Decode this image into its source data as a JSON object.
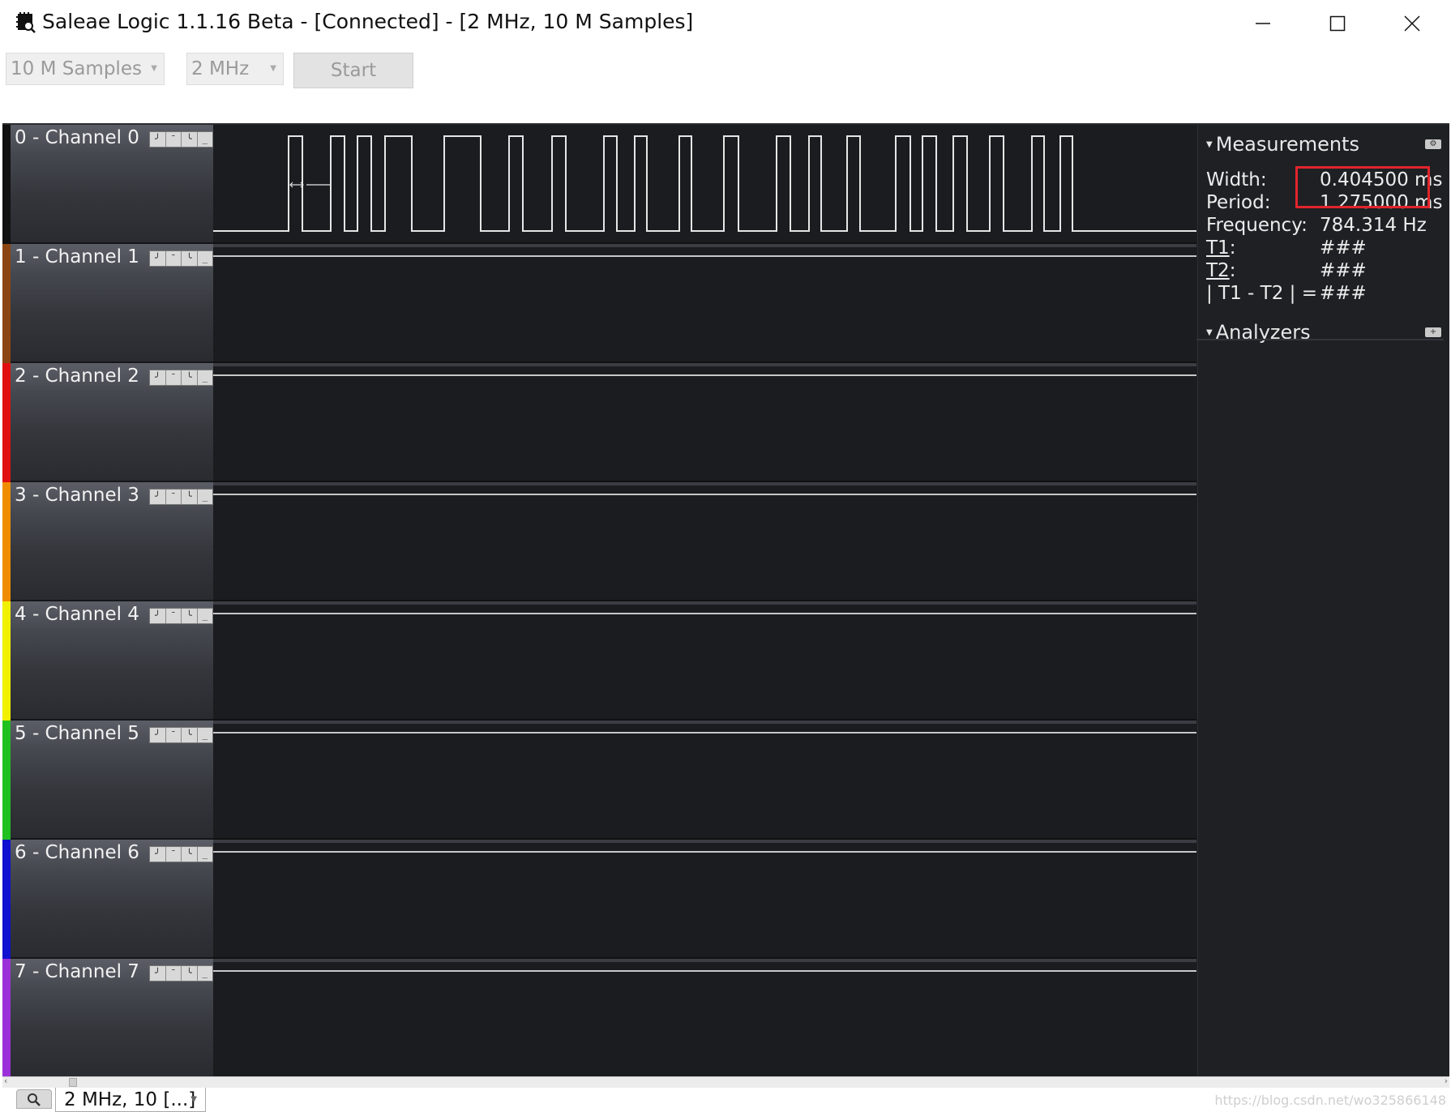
{
  "window": {
    "title": "Saleae Logic 1.1.16 Beta - [Connected] - [2 MHz, 10 M Samples]",
    "app_icon": "saleae-logo-icon",
    "controls": [
      "minimize-icon",
      "maximize-icon",
      "close-icon"
    ]
  },
  "toolbar": {
    "samples_value": "10 M Samples",
    "rate_value": "2 MHz",
    "start_label": "Start"
  },
  "channels": [
    {
      "label": "0 - Channel 0",
      "color": "#111111",
      "has_signal": true
    },
    {
      "label": "1 - Channel 1",
      "color": "#8b4513",
      "has_signal": false
    },
    {
      "label": "2 - Channel 2",
      "color": "#e01010",
      "has_signal": false
    },
    {
      "label": "3 - Channel 3",
      "color": "#f08c00",
      "has_signal": false
    },
    {
      "label": "4 - Channel 4",
      "color": "#f0f000",
      "has_signal": false
    },
    {
      "label": "5 - Channel 5",
      "color": "#20c020",
      "has_signal": false
    },
    {
      "label": "6 - Channel 6",
      "color": "#1010d0",
      "has_signal": false
    },
    {
      "label": "7 - Channel 7",
      "color": "#9b30d9",
      "has_signal": false
    }
  ],
  "trigger_buttons": [
    "rising-edge-icon",
    "high-level-icon",
    "falling-edge-icon",
    "low-level-icon"
  ],
  "measurements": {
    "title": "Measurements",
    "rows": [
      {
        "key": "Width:",
        "value": "0.404500 ms"
      },
      {
        "key": "Period:",
        "value": "1.275000 ms"
      },
      {
        "key": "Frequency:",
        "value": "784.314 Hz"
      },
      {
        "key": "T1",
        "suffix": ":",
        "value": "###"
      },
      {
        "key": "T2",
        "suffix": ":",
        "value": "###"
      },
      {
        "key": "| T1 - T2 | =",
        "value": "###"
      }
    ],
    "highlight_color": "#e1252c"
  },
  "analyzers": {
    "title": "Analyzers"
  },
  "tabs": {
    "session_label": "2 MHz, 10 [...]"
  },
  "watermark": "https://blog.csdn.net/wo325866148"
}
